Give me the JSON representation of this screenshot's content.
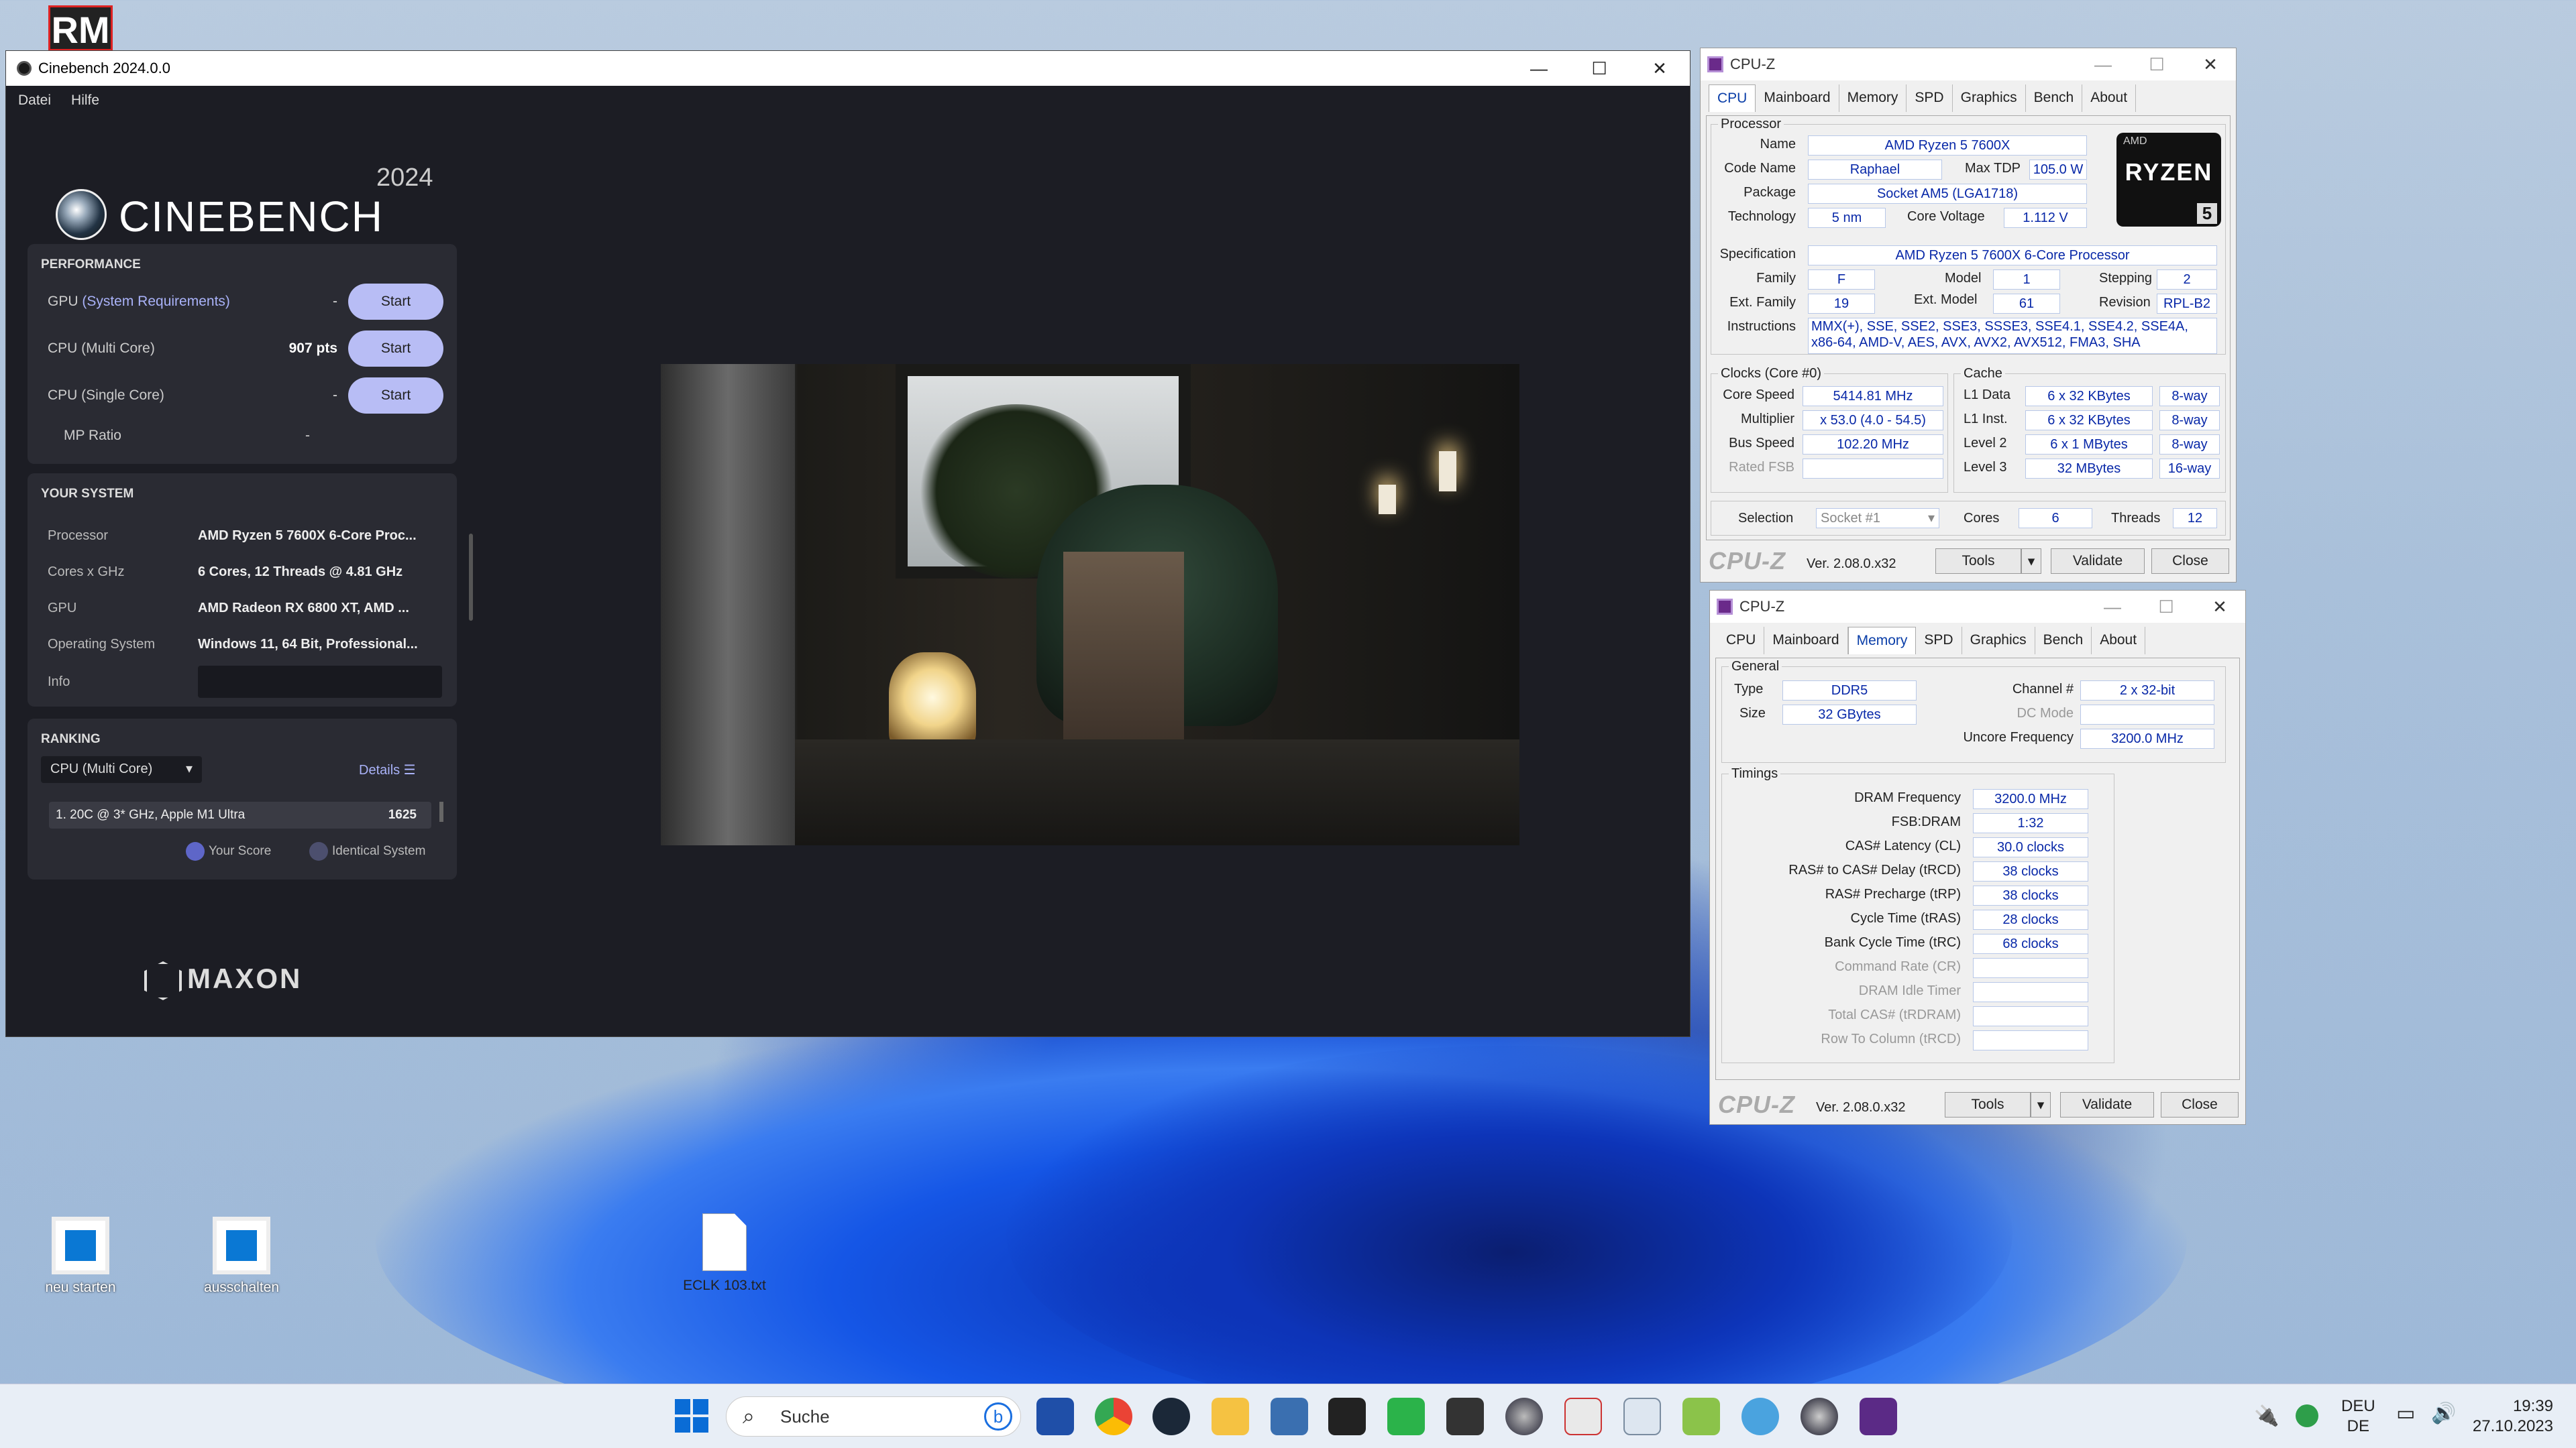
{
  "desktop": {
    "rm_logo": "RM",
    "icons": [
      {
        "label": "neu starten"
      },
      {
        "label": "ausschalten"
      },
      {
        "label": "ECLK 103.txt"
      }
    ]
  },
  "cinebench": {
    "title": "Cinebench 2024.0.0",
    "menu": [
      "Datei",
      "Hilfe"
    ],
    "brand": "CINEBENCH",
    "year": "2024",
    "performance": {
      "heading": "PERFORMANCE",
      "rows": [
        {
          "label_pre": "GPU ",
          "label_link": "(System Requirements)",
          "value": "-",
          "button": "Start"
        },
        {
          "label": "CPU (Multi Core)",
          "value": "907 pts",
          "button": "Start"
        },
        {
          "label": "CPU (Single Core)",
          "value": "-",
          "button": "Start"
        },
        {
          "label": "MP Ratio",
          "value": "-"
        }
      ]
    },
    "system": {
      "heading": "YOUR SYSTEM",
      "rows": [
        {
          "k": "Processor",
          "v": "AMD Ryzen 5 7600X 6-Core Proc..."
        },
        {
          "k": "Cores x GHz",
          "v": "6 Cores, 12 Threads @ 4.81 GHz"
        },
        {
          "k": "GPU",
          "v": "AMD Radeon RX 6800 XT, AMD ..."
        },
        {
          "k": "Operating System",
          "v": "Windows 11, 64 Bit, Professional..."
        },
        {
          "k": "Info",
          "v": ""
        }
      ]
    },
    "ranking": {
      "heading": "RANKING",
      "select": "CPU (Multi Core)",
      "details": "Details",
      "entry": {
        "name": "1. 20C @ 3* GHz, Apple M1 Ultra",
        "score": "1625"
      },
      "legend": [
        "Your Score",
        "Identical System"
      ]
    },
    "maxon": "MAXON"
  },
  "cpuz_cpu": {
    "title": "CPU-Z",
    "tabs": [
      "CPU",
      "Mainboard",
      "Memory",
      "SPD",
      "Graphics",
      "Bench",
      "About"
    ],
    "processor": {
      "group": "Processor",
      "name_l": "Name",
      "name": "AMD Ryzen 5 7600X",
      "code_l": "Code Name",
      "code": "Raphael",
      "tdp_l": "Max TDP",
      "tdp": "105.0 W",
      "pkg_l": "Package",
      "pkg": "Socket AM5 (LGA1718)",
      "tech_l": "Technology",
      "tech": "5 nm",
      "volt_l": "Core Voltage",
      "volt": "1.112 V",
      "spec_l": "Specification",
      "spec": "AMD Ryzen 5 7600X 6-Core Processor",
      "fam_l": "Family",
      "fam": "F",
      "model_l": "Model",
      "model": "1",
      "step_l": "Stepping",
      "step": "2",
      "efam_l": "Ext. Family",
      "efam": "19",
      "emodel_l": "Ext. Model",
      "emodel": "61",
      "rev_l": "Revision",
      "rev": "RPL-B2",
      "instr_l": "Instructions",
      "instr1": "MMX(+), SSE, SSE2, SSE3, SSSE3, SSE4.1, SSE4.2, SSE4A,",
      "instr2": "x86-64, AMD-V, AES, AVX, AVX2, AVX512, FMA3, SHA",
      "logo_amd": "AMD",
      "logo_ryzen": "RYZEN",
      "logo_num": "5"
    },
    "clocks": {
      "group": "Clocks (Core #0)",
      "speed_l": "Core Speed",
      "speed": "5414.81 MHz",
      "mult_l": "Multiplier",
      "mult": "x 53.0 (4.0 - 54.5)",
      "bus_l": "Bus Speed",
      "bus": "102.20 MHz",
      "fsb_l": "Rated FSB",
      "fsb": ""
    },
    "cache": {
      "group": "Cache",
      "rows": [
        {
          "l": "L1 Data",
          "v": "6 x 32 KBytes",
          "w": "8-way"
        },
        {
          "l": "L1 Inst.",
          "v": "6 x 32 KBytes",
          "w": "8-way"
        },
        {
          "l": "Level 2",
          "v": "6 x 1 MBytes",
          "w": "8-way"
        },
        {
          "l": "Level 3",
          "v": "32 MBytes",
          "w": "16-way"
        }
      ]
    },
    "sel_l": "Selection",
    "sel": "Socket #1",
    "cores_l": "Cores",
    "cores": "6",
    "threads_l": "Threads",
    "threads": "12",
    "footer": {
      "logo": "CPU-Z",
      "ver": "Ver. 2.08.0.x32",
      "tools": "Tools",
      "validate": "Validate",
      "close": "Close"
    }
  },
  "cpuz_mem": {
    "title": "CPU-Z",
    "tabs": [
      "CPU",
      "Mainboard",
      "Memory",
      "SPD",
      "Graphics",
      "Bench",
      "About"
    ],
    "general": {
      "group": "General",
      "type_l": "Type",
      "type": "DDR5",
      "size_l": "Size",
      "size": "32 GBytes",
      "ch_l": "Channel #",
      "ch": "2 x 32-bit",
      "dc_l": "DC Mode",
      "dc": "",
      "unc_l": "Uncore Frequency",
      "unc": "3200.0 MHz"
    },
    "timings": {
      "group": "Timings",
      "rows": [
        {
          "l": "DRAM Frequency",
          "v": "3200.0 MHz",
          "g": false
        },
        {
          "l": "FSB:DRAM",
          "v": "1:32",
          "g": false
        },
        {
          "l": "CAS# Latency (CL)",
          "v": "30.0 clocks",
          "g": false
        },
        {
          "l": "RAS# to CAS# Delay (tRCD)",
          "v": "38 clocks",
          "g": false
        },
        {
          "l": "RAS# Precharge (tRP)",
          "v": "38 clocks",
          "g": false
        },
        {
          "l": "Cycle Time (tRAS)",
          "v": "28 clocks",
          "g": false
        },
        {
          "l": "Bank Cycle Time (tRC)",
          "v": "68 clocks",
          "g": false
        },
        {
          "l": "Command Rate (CR)",
          "v": "",
          "g": true
        },
        {
          "l": "DRAM Idle Timer",
          "v": "",
          "g": true
        },
        {
          "l": "Total CAS# (tRDRAM)",
          "v": "",
          "g": true
        },
        {
          "l": "Row To Column (tRCD)",
          "v": "",
          "g": true
        }
      ]
    },
    "footer": {
      "logo": "CPU-Z",
      "ver": "Ver. 2.08.0.x32",
      "tools": "Tools",
      "validate": "Validate",
      "close": "Close"
    }
  },
  "taskbar": {
    "search": "Suche",
    "lang1": "DEU",
    "lang2": "DE",
    "time": "19:39",
    "date": "27.10.2023"
  }
}
